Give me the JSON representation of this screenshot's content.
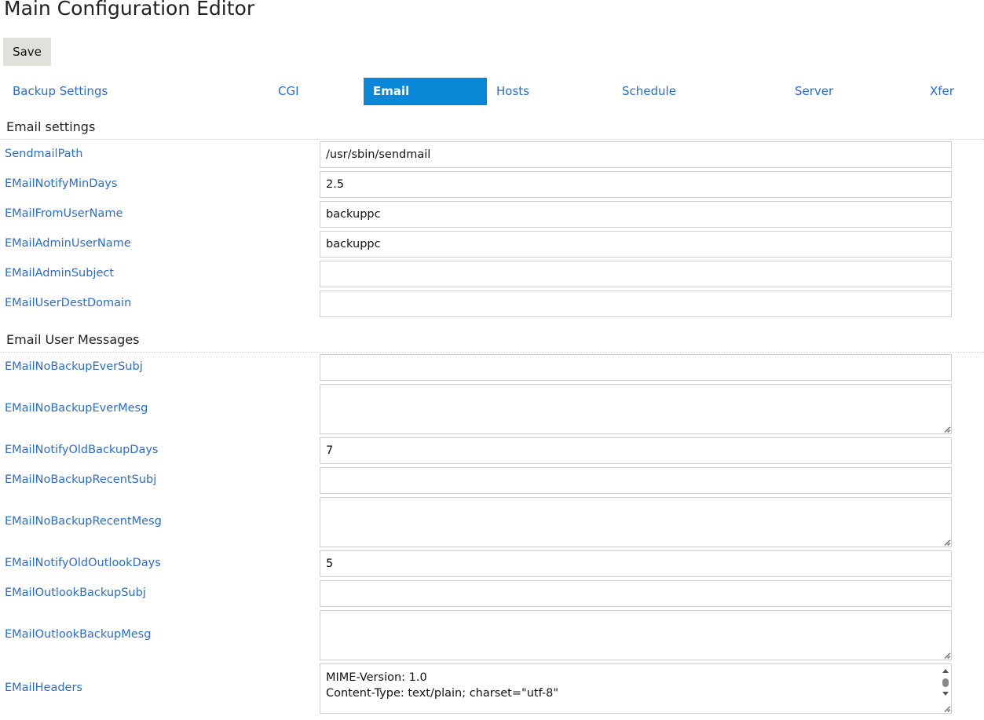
{
  "page": {
    "title": "Main Configuration Editor",
    "save_label": "Save"
  },
  "tabs": [
    {
      "label": "Backup Settings",
      "active": false
    },
    {
      "label": "CGI",
      "active": false
    },
    {
      "label": "Email",
      "active": true
    },
    {
      "label": "Hosts",
      "active": false
    },
    {
      "label": "Schedule",
      "active": false
    },
    {
      "label": "Server",
      "active": false
    },
    {
      "label": "Xfer",
      "active": false
    }
  ],
  "sections": {
    "email_settings": {
      "header": "Email settings",
      "fields": [
        {
          "label": "SendmailPath",
          "value": "/usr/sbin/sendmail"
        },
        {
          "label": "EMailNotifyMinDays",
          "value": "2.5"
        },
        {
          "label": "EMailFromUserName",
          "value": "backuppc"
        },
        {
          "label": "EMailAdminUserName",
          "value": "backuppc"
        },
        {
          "label": "EMailAdminSubject",
          "value": ""
        },
        {
          "label": "EMailUserDestDomain",
          "value": ""
        }
      ]
    },
    "email_user_messages": {
      "header": "Email User Messages",
      "fields": [
        {
          "label": "EMailNoBackupEverSubj",
          "value": ""
        },
        {
          "label": "EMailNoBackupEverMesg",
          "value": ""
        },
        {
          "label": "EMailNotifyOldBackupDays",
          "value": "7"
        },
        {
          "label": "EMailNoBackupRecentSubj",
          "value": ""
        },
        {
          "label": "EMailNoBackupRecentMesg",
          "value": ""
        },
        {
          "label": "EMailNotifyOldOutlookDays",
          "value": "5"
        },
        {
          "label": "EMailOutlookBackupSubj",
          "value": ""
        },
        {
          "label": "EMailOutlookBackupMesg",
          "value": ""
        },
        {
          "label": "EMailHeaders",
          "value": "MIME-Version: 1.0\nContent-Type: text/plain; charset=\"utf-8\""
        }
      ]
    }
  },
  "colors": {
    "link": "#2a6dca",
    "active_tab_bg": "#0a87d6",
    "save_bg": "#e1e1dc",
    "input_border": "#cfcfcf"
  },
  "icons": {
    "resize_grip": "resize-grip-icon",
    "scroll_up": "scroll-up-arrow-icon",
    "scroll_down": "scroll-down-arrow-icon"
  }
}
